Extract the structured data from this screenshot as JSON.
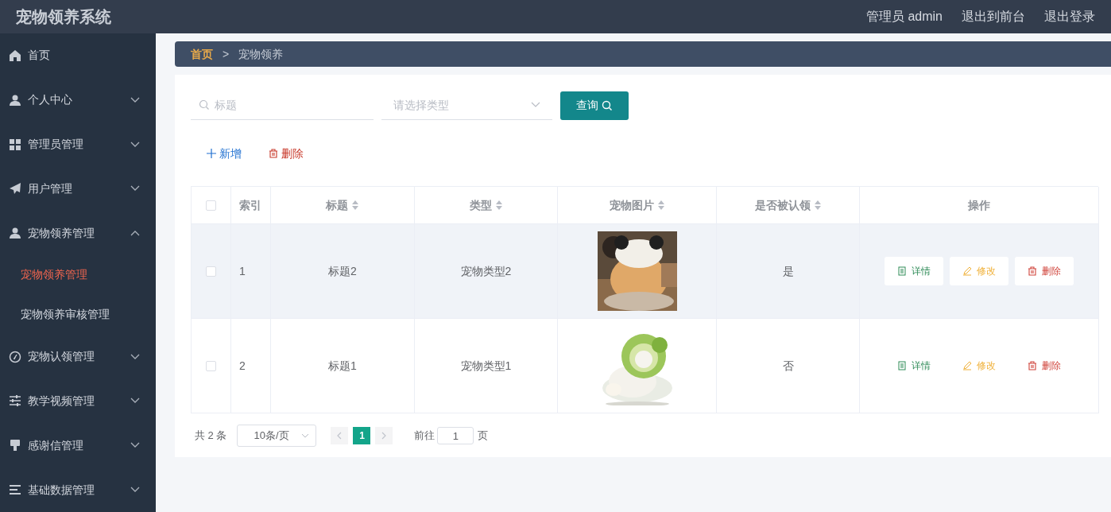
{
  "header": {
    "title": "宠物领养系统",
    "links": [
      "管理员 admin",
      "退出到前台",
      "退出登录"
    ]
  },
  "sidebar": {
    "items": [
      {
        "label": "首页"
      },
      {
        "label": "个人中心",
        "expanded": false
      },
      {
        "label": "管理员管理",
        "expanded": false
      },
      {
        "label": "用户管理",
        "expanded": false
      },
      {
        "label": "宠物领养管理",
        "expanded": true,
        "children": [
          {
            "label": "宠物领养管理",
            "selected": true
          },
          {
            "label": "宠物领养审核管理",
            "selected": false
          }
        ]
      },
      {
        "label": "宠物认领管理",
        "expanded": false
      },
      {
        "label": "教学视频管理",
        "expanded": false
      },
      {
        "label": "感谢信管理",
        "expanded": false
      },
      {
        "label": "基础数据管理",
        "expanded": false
      }
    ]
  },
  "breadcrumb": [
    "首页",
    "宠物领养"
  ],
  "breadcrumb_separator": ">",
  "search": {
    "title_placeholder": "标题",
    "type_placeholder": "请选择类型",
    "button": "查询"
  },
  "actions": {
    "add": "新增",
    "delete": "删除"
  },
  "table": {
    "all_checked": false,
    "columns": [
      {
        "label": "索引",
        "sortable": false
      },
      {
        "label": "标题",
        "sortable": true
      },
      {
        "label": "类型",
        "sortable": true
      },
      {
        "label": "宠物图片",
        "sortable": true
      },
      {
        "label": "是否被认领",
        "sortable": true
      },
      {
        "label": "操作",
        "sortable": false
      }
    ],
    "rows": [
      {
        "checked": false,
        "highlighted": true,
        "index": "1",
        "title": "标题2",
        "type": "宠物类型2",
        "claimed": "是",
        "buttons": [
          "详情",
          "修改",
          "删除"
        ]
      },
      {
        "checked": false,
        "highlighted": false,
        "index": "2",
        "title": "标题1",
        "type": "宠物类型1",
        "claimed": "否",
        "buttons": [
          "详情",
          "修改",
          "删除"
        ]
      }
    ]
  },
  "pagination": {
    "total": "共 2 条",
    "page_size": "10条/页",
    "pages": [
      {
        "label": "1",
        "selected": true
      }
    ],
    "goto_label": "前往",
    "goto_value": "1",
    "goto_suffix": "页"
  }
}
